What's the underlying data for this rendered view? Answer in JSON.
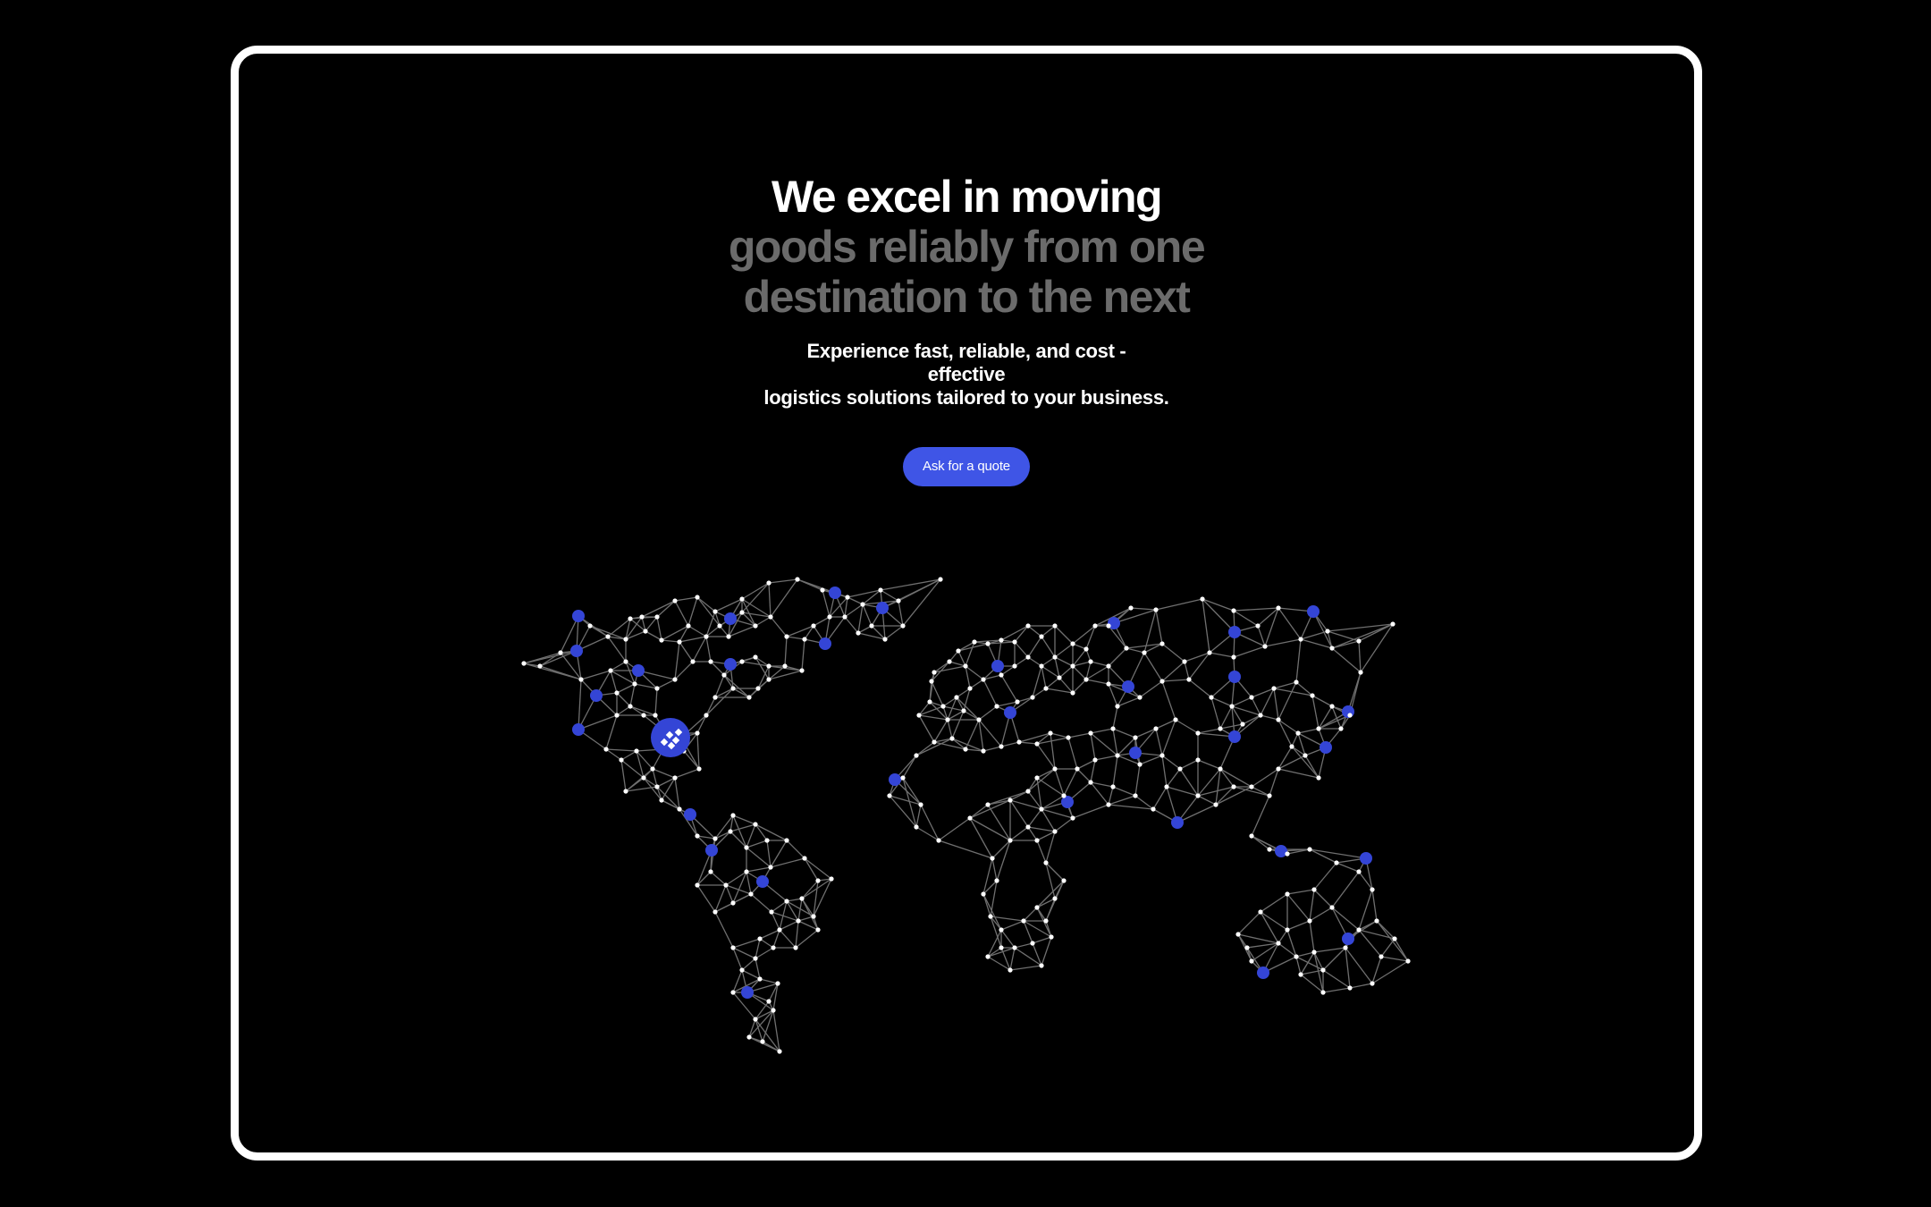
{
  "hero": {
    "headline": {
      "line1": "We excel in moving",
      "line2": "goods reliably from one",
      "line3": "destination to the next"
    },
    "subtitle": {
      "line1": "Experience fast, reliable, and cost -",
      "line2": "effective",
      "line3": "logistics solutions tailored to your business."
    },
    "cta_label": "Ask for a quote"
  },
  "map": {
    "icons": {
      "hub": "location-hub-icon",
      "node": "network-node-icon",
      "origin": "logistics-origin-icon"
    },
    "colors": {
      "accent": "#3f55e6",
      "hub": "#3445d6",
      "node": "#ffffff",
      "link": "#6f6f6f",
      "frame": "#ffffff",
      "background": "#000000"
    }
  }
}
